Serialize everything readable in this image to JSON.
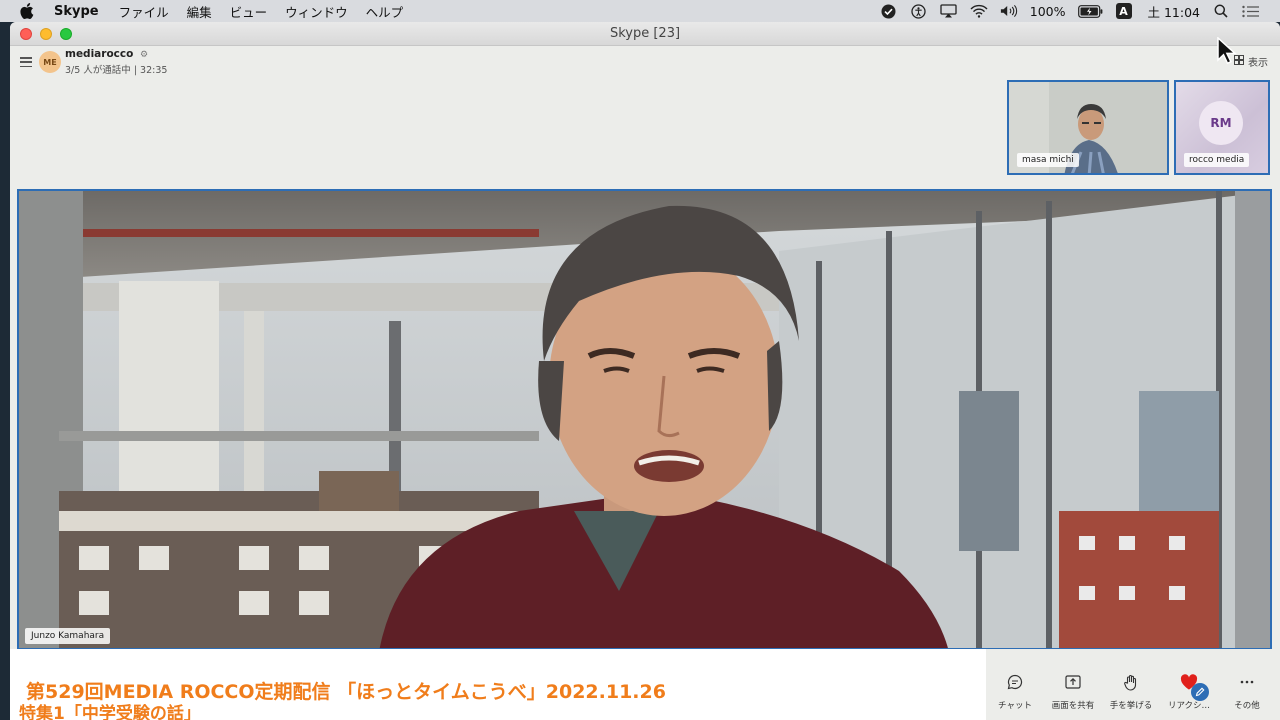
{
  "menubar": {
    "app_name": "Skype",
    "menus": [
      "ファイル",
      "編集",
      "ビュー",
      "ウィンドウ",
      "ヘルプ"
    ],
    "battery": "100%",
    "input_badge": "A",
    "clock": "土 11:04"
  },
  "window": {
    "title": "Skype [23]"
  },
  "call_header": {
    "avatar_initials": "ME",
    "group_name": "mediarocco",
    "status": "3/5 人が通話中 | 32:35",
    "view_label": "表示"
  },
  "participants": [
    {
      "name": "masa michi"
    },
    {
      "name": "rocco media",
      "initials": "RM"
    }
  ],
  "main_video": {
    "speaker": "Junzo Kamahara"
  },
  "caption": {
    "line1": "第529回MEDIA ROCCO定期配信 「ほっとタイムこうべ」2022.11.26",
    "line2": "特集1「中学受験の話」"
  },
  "controls": [
    {
      "label": "チャット",
      "icon": "chat-icon"
    },
    {
      "label": "画面を共有",
      "icon": "share-screen-icon"
    },
    {
      "label": "手を挙げる",
      "icon": "raise-hand-icon"
    },
    {
      "label": "リアクシ…",
      "icon": "heart-icon"
    },
    {
      "label": "その他",
      "icon": "more-icon"
    }
  ],
  "colors": {
    "accent_border": "#2d6db5",
    "caption_orange": "#f07d1b",
    "reaction_red": "#e0201b"
  }
}
